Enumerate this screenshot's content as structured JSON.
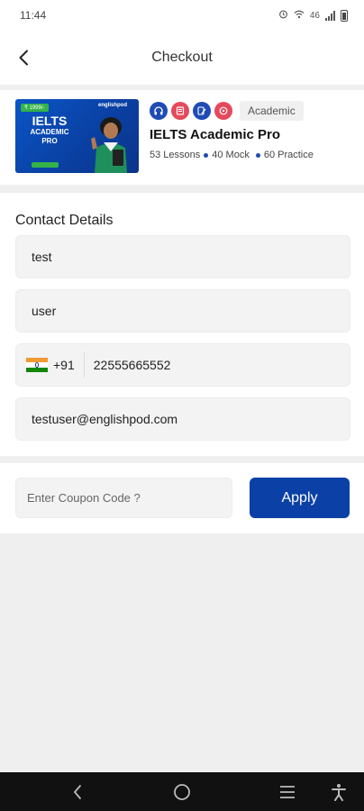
{
  "status_bar": {
    "time": "11:44",
    "network": "46"
  },
  "header": {
    "title": "Checkout",
    "back_icon": "chevron-left-icon"
  },
  "course": {
    "thumbnail": {
      "tag": "₹ 1999/-",
      "brand": "englishpod",
      "title_line1": "IELTS",
      "title_line2": "ACADEMIC",
      "title_line3": "PRO"
    },
    "feature_icons": [
      "headphones-icon",
      "book-icon",
      "pencil-icon",
      "chat-icon"
    ],
    "category": "Academic",
    "name": "IELTS Academic Pro",
    "stats": [
      "53 Lessons",
      "40 Mock",
      "60 Practice"
    ]
  },
  "contact": {
    "title": "Contact Details",
    "first_name": "test",
    "last_name": "user",
    "country_code": "+91",
    "phone": "22555665552",
    "email": "testuser@englishpod.com"
  },
  "coupon": {
    "placeholder": "Enter Coupon Code ?",
    "apply_label": "Apply"
  },
  "colors": {
    "primary": "#0b41a6",
    "accent_red": "#e44a5c",
    "accent_blue": "#1f4bb5"
  }
}
